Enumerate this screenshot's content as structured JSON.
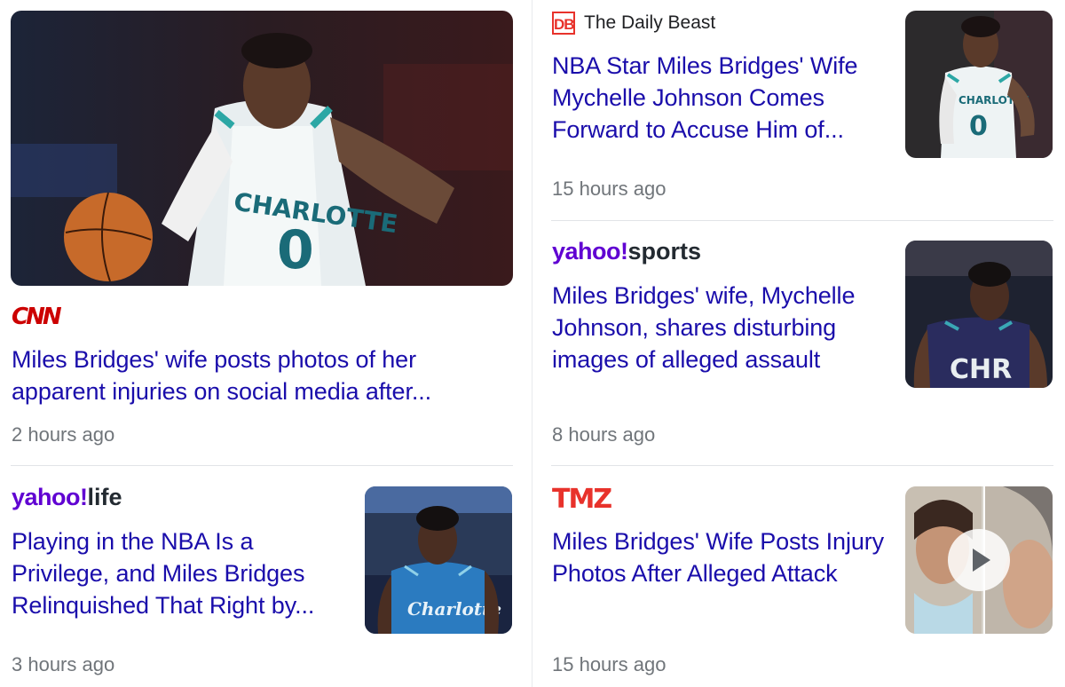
{
  "articles": [
    {
      "source": "CNN",
      "headline": "Miles Bridges' wife posts photos of her apparent injuries on social media after...",
      "time": "2 hours ago",
      "image": "basketball-player-dribbling"
    },
    {
      "source": "The Daily Beast",
      "source_badge": "DB",
      "headline": "NBA Star Miles Bridges' Wife Mychelle Johnson Comes Forward to Accuse Him of...",
      "time": "15 hours ago",
      "image": "basketball-player-celebrating"
    },
    {
      "source_brand": "yahoo!",
      "source_section": "sports",
      "headline": "Miles Bridges' wife, Mychelle Johnson, shares disturbing images of alleged assault",
      "time": "8 hours ago",
      "image": "basketball-player-charlotte-jersey"
    },
    {
      "source_brand": "yahoo!",
      "source_section": "life",
      "headline": "Playing in the NBA Is a Privilege, and Miles Bridges Relinquished That Right by...",
      "time": "3 hours ago",
      "image": "basketball-player-head-down"
    },
    {
      "source": "TMZ",
      "headline": "Miles Bridges' Wife Posts Injury Photos After Alleged Attack",
      "time": "15 hours ago",
      "image": "video-thumbnail-injury-photos"
    }
  ],
  "colors": {
    "link": "#1a0dab",
    "meta": "#70757a",
    "cnn": "#cc0000",
    "yahoo": "#6001d2",
    "tmz": "#e8322b"
  }
}
